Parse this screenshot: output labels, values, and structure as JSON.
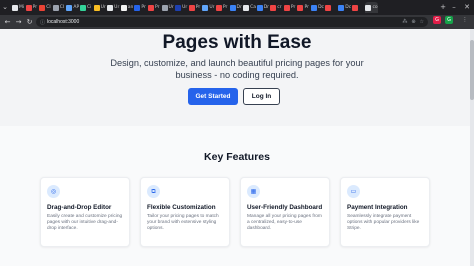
{
  "browser": {
    "tabs": [
      {
        "label": "Mi",
        "color": "#e5e7eb"
      },
      {
        "label": "Pr",
        "color": "#ef4444"
      },
      {
        "label": "Cl",
        "color": "#ea4335"
      },
      {
        "label": "Cl",
        "color": "#9ca3af"
      },
      {
        "label": "AP",
        "color": "#60a5fa"
      },
      {
        "label": "Ci",
        "color": "#34d399"
      },
      {
        "label": "Ur",
        "color": "#fbbf24"
      },
      {
        "label": "Ur",
        "color": "#e5e7eb"
      },
      {
        "label": "an",
        "color": "#f5f5f5"
      },
      {
        "label": "Pr",
        "color": "#2563eb"
      },
      {
        "label": "Pr",
        "color": "#ef4444"
      },
      {
        "label": "Ur",
        "color": "#9ca3af"
      },
      {
        "label": "Ur",
        "color": "#1e40af"
      },
      {
        "label": "Pr",
        "color": "#ef4444"
      },
      {
        "label": "Ur",
        "color": "#60a5fa"
      },
      {
        "label": "Pr",
        "color": "#ef4444"
      },
      {
        "label": "Dr",
        "color": "#3b82f6"
      },
      {
        "label": "Ca",
        "color": "#e5e7eb"
      },
      {
        "label": "Dr",
        "color": "#3b82f6"
      },
      {
        "label": "cr",
        "color": "#ef4444"
      },
      {
        "label": "Pr",
        "color": "#ef4444"
      },
      {
        "label": "Pr",
        "color": "#ef4444"
      },
      {
        "label": "Dc",
        "color": "#3b82f6"
      },
      {
        "label": "",
        "color": "#ef4444"
      },
      {
        "label": "Dc",
        "color": "#3b82f6"
      },
      {
        "label": "",
        "color": "#ef4444"
      },
      {
        "label": "co",
        "color": "#e5e7eb"
      }
    ],
    "url": "localhost:3000",
    "extension_badges": [
      {
        "label": "G",
        "color": "#e11d48"
      },
      {
        "label": "G",
        "color": "#16a34a"
      }
    ]
  },
  "hero": {
    "title": "Pages with Ease",
    "subtitle": "Design, customize, and launch beautiful pricing pages for your business - no coding required.",
    "primary_button": "Get Started",
    "secondary_button": "Log In",
    "accent_color": "#2563eb"
  },
  "features": {
    "heading": "Key Features",
    "items": [
      {
        "title": "Drag-and-Drop Editor",
        "description": "Easily create and customize pricing pages with our intuitive drag-and-drop interface.",
        "icon": "grid-icon"
      },
      {
        "title": "Flexible Customization",
        "description": "Tailor your pricing pages to match your brand with extensive styling options.",
        "icon": "sliders-icon"
      },
      {
        "title": "User-Friendly Dashboard",
        "description": "Manage all your pricing pages from a centralized, easy-to-use dashboard.",
        "icon": "dashboard-icon"
      },
      {
        "title": "Payment Integration",
        "description": "Seamlessly integrate payment options with popular providers like Stripe.",
        "icon": "credit-card-icon"
      }
    ]
  }
}
